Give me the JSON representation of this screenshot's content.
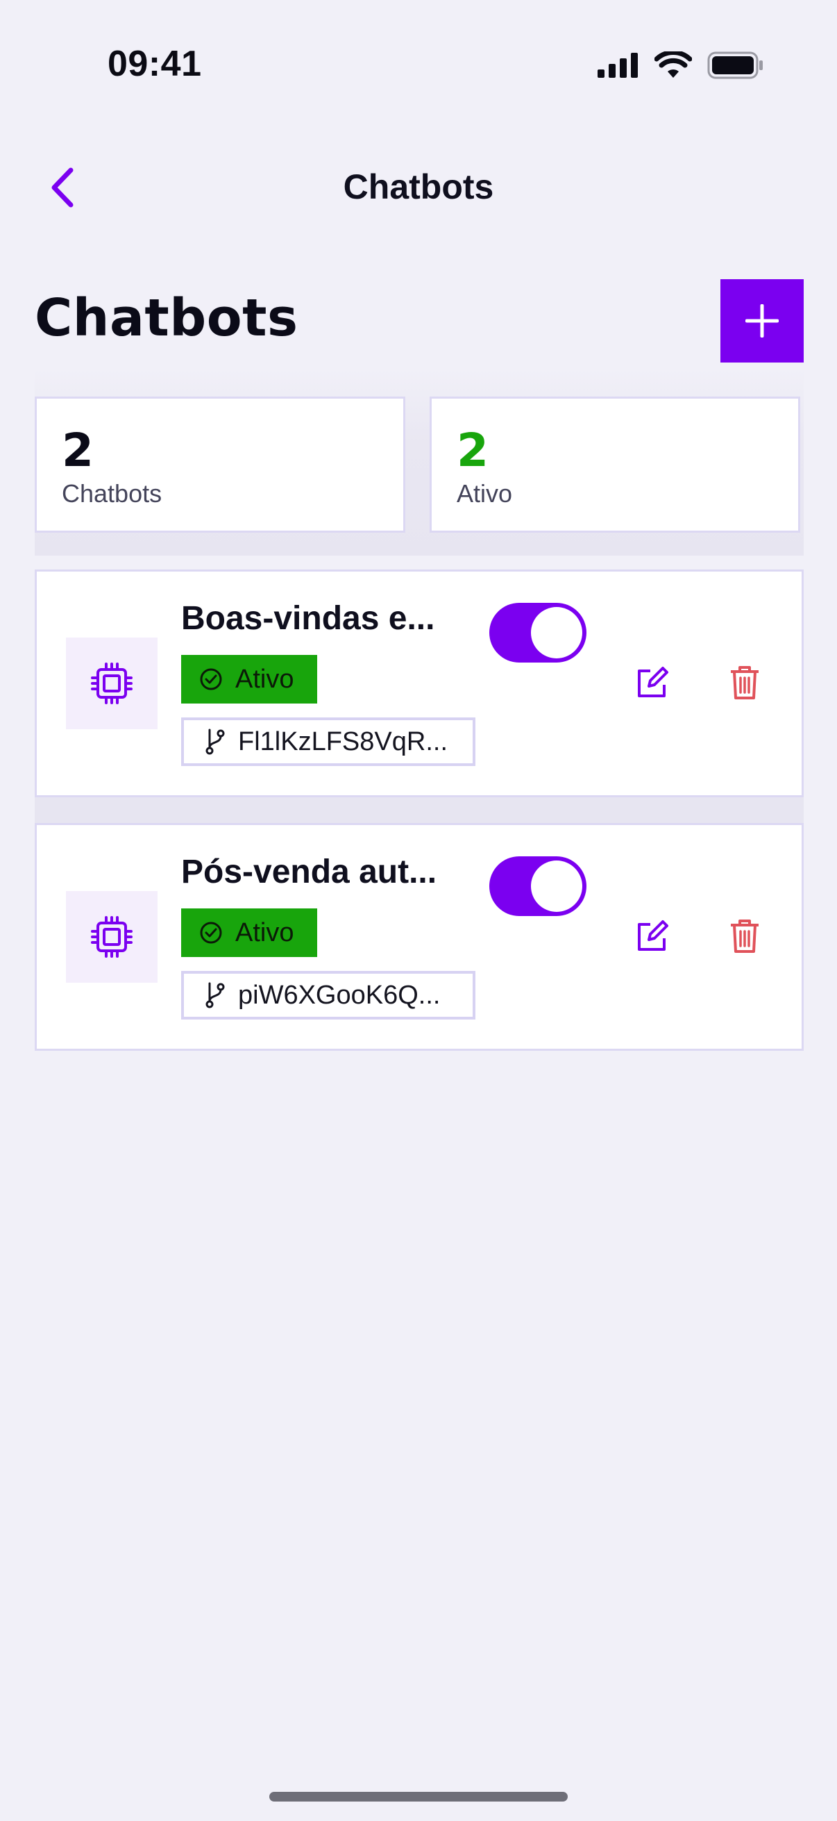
{
  "status_bar": {
    "time": "09:41"
  },
  "nav": {
    "title": "Chatbots"
  },
  "page": {
    "title": "Chatbots"
  },
  "stats": [
    {
      "value": "2",
      "label": "Chatbots",
      "color": "#0b0b18"
    },
    {
      "value": "2",
      "label": "Ativo",
      "color": "#18a50c"
    }
  ],
  "chatbots": [
    {
      "name": "Boas-vindas e...",
      "status": "Ativo",
      "id": "Fl1lKzLFS8VqR...",
      "enabled": true
    },
    {
      "name": "Pós-venda aut...",
      "status": "Ativo",
      "id": "piW6XGooK6Q...",
      "enabled": true
    }
  ],
  "colors": {
    "accent": "#7b00f0",
    "active_badge": "#18a50c",
    "delete": "#e0525a",
    "background": "#f1f0f8"
  },
  "icons": {
    "back": "chevron-left-icon",
    "add": "plus-icon",
    "bot": "cpu-chip-icon",
    "status": "check-circle-icon",
    "id": "git-branch-icon",
    "edit": "edit-icon",
    "delete": "trash-icon"
  }
}
